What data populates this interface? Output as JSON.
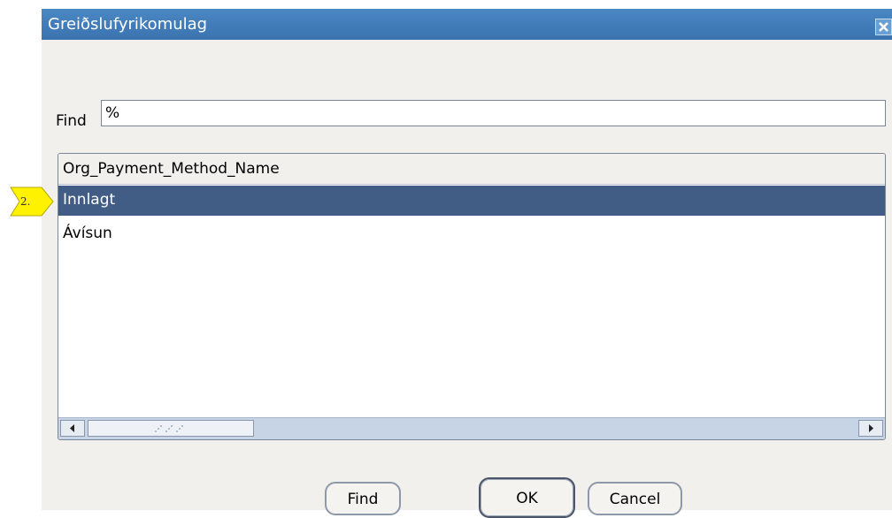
{
  "dialog": {
    "title": "Greiðslufyrikomulag",
    "close_icon": "close-icon"
  },
  "find": {
    "label": "Find",
    "value": "%"
  },
  "list": {
    "column_header": "Org_Payment_Method_Name",
    "rows": [
      "Innlagt",
      "Ávísun"
    ],
    "selected_index": 0
  },
  "buttons": {
    "find_label": "Find",
    "ok_label": "OK",
    "cancel_label": "Cancel"
  },
  "annotation": {
    "step_label": "2."
  },
  "colors": {
    "titlebar": "#3a73b0",
    "selection": "#415c85",
    "marker": "#fff200"
  }
}
